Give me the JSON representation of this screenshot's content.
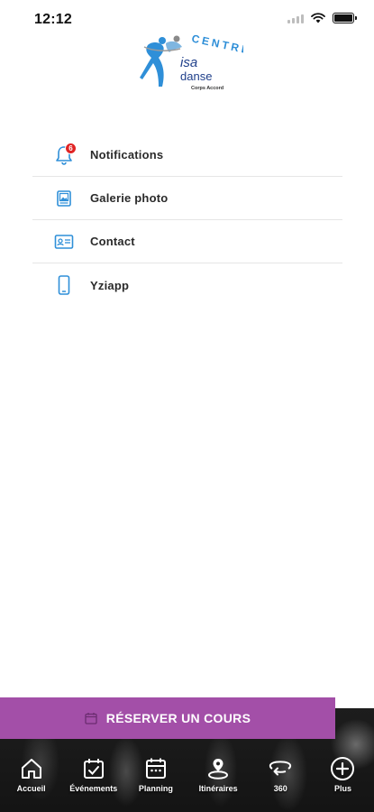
{
  "status_bar": {
    "time": "12:12"
  },
  "logo": {
    "word_centre": "CENTRE",
    "word_isa": "isa",
    "word_danse": "danse",
    "tagline": "Corps Accord"
  },
  "menu": {
    "items": [
      {
        "label": "Notifications",
        "icon": "bell-icon",
        "badge": "6"
      },
      {
        "label": "Galerie photo",
        "icon": "photo-gallery-icon"
      },
      {
        "label": "Contact",
        "icon": "contact-card-icon"
      },
      {
        "label": "Yziapp",
        "icon": "smartphone-icon"
      }
    ]
  },
  "cta": {
    "label": "RÉSERVER UN COURS",
    "icon": "calendar-icon",
    "color": "#a34fa8"
  },
  "tabbar": {
    "items": [
      {
        "label": "Accueil",
        "icon": "home-icon"
      },
      {
        "label": "Événements",
        "icon": "calendar-check-icon"
      },
      {
        "label": "Planning",
        "icon": "calendar-grid-icon"
      },
      {
        "label": "Itinéraires",
        "icon": "map-pin-icon"
      },
      {
        "label": "360",
        "icon": "rotate-360-icon"
      },
      {
        "label": "Plus",
        "icon": "plus-circle-icon"
      }
    ]
  },
  "colors": {
    "accent_blue": "#2f8fd8",
    "cta_purple": "#a34fa8",
    "badge_red": "#e02424"
  }
}
